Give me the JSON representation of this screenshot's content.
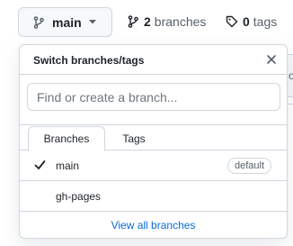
{
  "branch_selector": {
    "current_branch": "main",
    "branch_icon": "git-branch-icon",
    "caret_icon": "triangle-down-icon"
  },
  "branches_link": {
    "count": "2",
    "label": "branches",
    "icon": "git-branch-icon"
  },
  "tags_link": {
    "count": "0",
    "label": "tags",
    "icon": "tag-icon"
  },
  "background": {
    "fragment_text": "or"
  },
  "dropdown": {
    "title": "Switch branches/tags",
    "close_icon": "x-icon",
    "filter_placeholder": "Find or create a branch...",
    "filter_value": "",
    "tabs": [
      {
        "label": "Branches",
        "selected": true
      },
      {
        "label": "Tags",
        "selected": false
      }
    ],
    "items": [
      {
        "name": "main",
        "checked": true,
        "badge": "default"
      },
      {
        "name": "gh-pages",
        "checked": false,
        "badge": ""
      }
    ],
    "view_all_label": "View all branches",
    "check_icon": "check-icon"
  },
  "colors": {
    "accent_link": "#0969da",
    "border": "#d0d7de",
    "button_bg": "#f6f8fa",
    "text": "#1f2328",
    "muted_text": "#57606a"
  }
}
